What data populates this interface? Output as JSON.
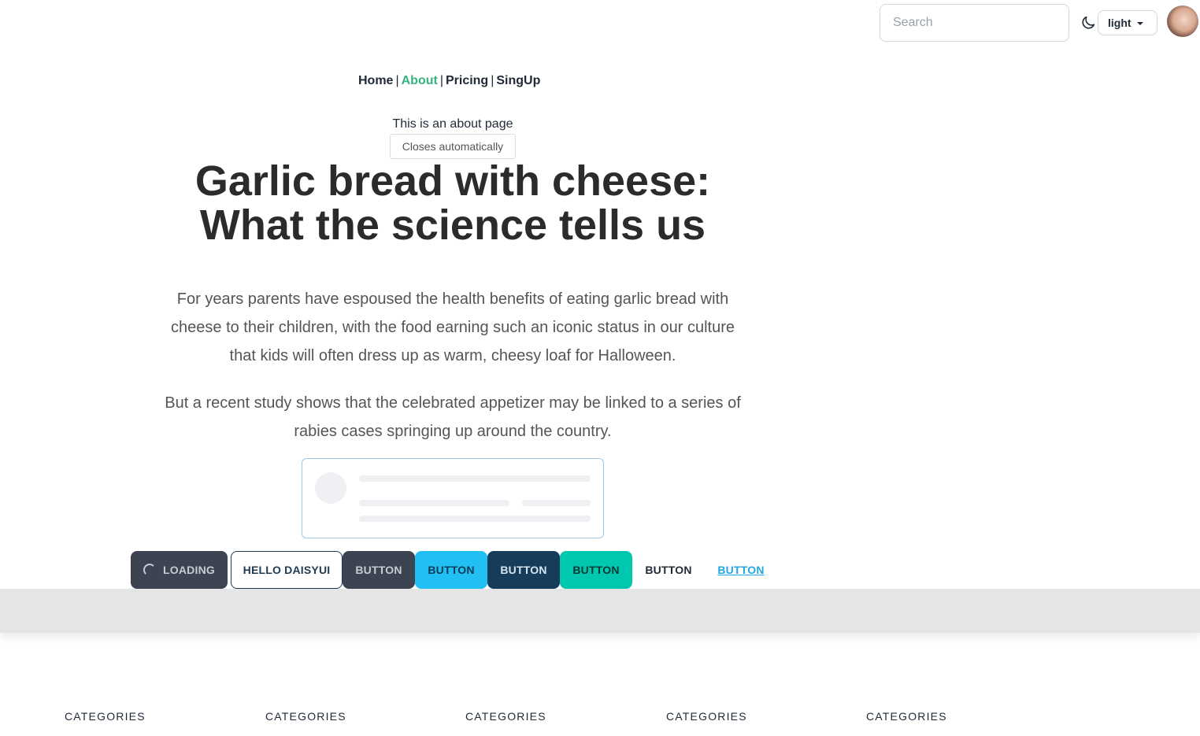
{
  "topbar": {
    "search_placeholder": "Search",
    "theme_icon": "moon-icon",
    "theme_value": "light",
    "avatar_icon": "user-avatar"
  },
  "nav": {
    "items": [
      {
        "label": "Home"
      },
      {
        "label": "About"
      },
      {
        "label": "Pricing"
      },
      {
        "label": "SingUp"
      }
    ],
    "separator": "|",
    "active_color": "#36b37e"
  },
  "about_text": "This is an about page",
  "toast": "Closes automatically",
  "article": {
    "headline_line1": "Garlic bread with cheese:",
    "headline_line2": "What the science tells us",
    "paragraph1": "For years parents have espoused the health benefits of eating garlic bread with cheese to their children, with the food earning such an iconic status in our culture that kids will often dress up as warm, cheesy loaf for Halloween.",
    "paragraph2": "But a recent study shows that the celebrated appetizer may be linked to a series of rabies cases springing up around the country."
  },
  "buttons": {
    "loading": "LOADING",
    "hello": "HELLO DAISYUI",
    "b1": "BUTTON",
    "b2": "BUTTON",
    "b3": "BUTTON",
    "b4": "BUTTON",
    "b5": "BUTTON",
    "b6": "BUTTON"
  },
  "footer": {
    "categories": [
      "CATEGORIES",
      "CATEGORIES",
      "CATEGORIES",
      "CATEGORIES",
      "CATEGORIES"
    ]
  }
}
